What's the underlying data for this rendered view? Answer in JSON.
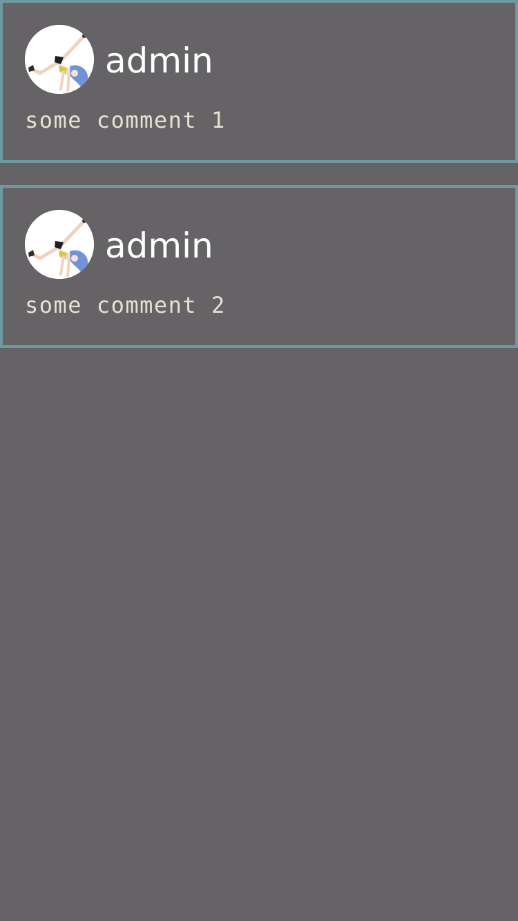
{
  "comments": [
    {
      "author": "admin",
      "avatar_icon": "anime-girl-avatar-icon",
      "text": "some comment 1"
    },
    {
      "author": "admin",
      "avatar_icon": "anime-girl-avatar-icon",
      "text": "some comment 2"
    }
  ],
  "colors": {
    "background": "#656366",
    "card_border": "#6c9aa3",
    "username": "#ffffff",
    "comment_text": "#e6e2d3"
  }
}
